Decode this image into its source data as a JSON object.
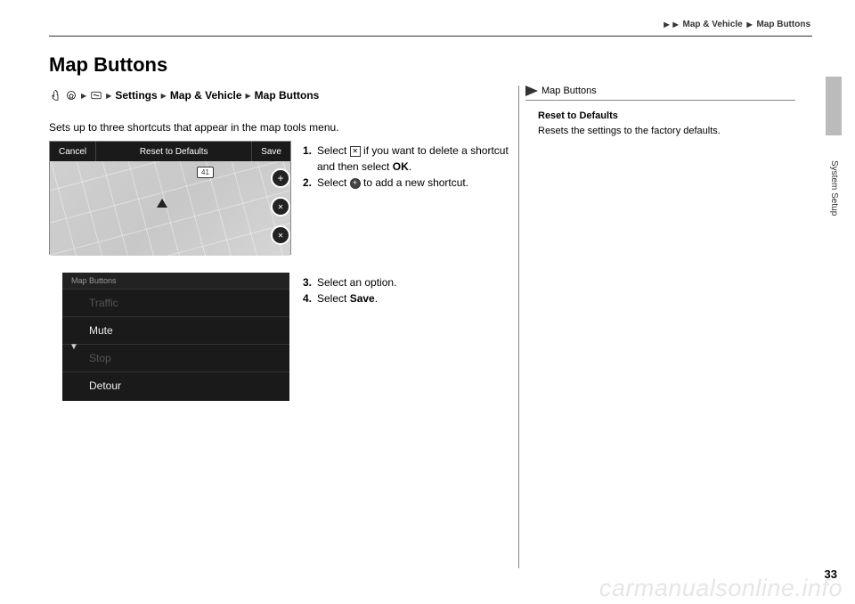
{
  "breadcrumb_top": {
    "level1": "Map & Vehicle",
    "level2": "Map Buttons"
  },
  "page_title": "Map Buttons",
  "path": {
    "settings": "Settings",
    "mv": "Map & Vehicle",
    "mb": "Map Buttons"
  },
  "intro": "Sets up to three shortcuts that appear in the map tools menu.",
  "shot1": {
    "cancel": "Cancel",
    "reset": "Reset to Defaults",
    "save": "Save",
    "badge": "41"
  },
  "shot2": {
    "header": "Map Buttons",
    "r1": "Traffic",
    "r2": "Mute",
    "r3": "Stop",
    "r4": "Detour"
  },
  "steps": {
    "s1_num": "1.",
    "s1_a": "Select ",
    "s1_b": " if you want to delete a shortcut and then select ",
    "s1_c": "OK",
    "s1_d": ".",
    "s2_num": "2.",
    "s2_a": "Select ",
    "s2_b": " to add a new shortcut.",
    "s3_num": "3.",
    "s3_a": "Select an option.",
    "s4_num": "4.",
    "s4_a": "Select ",
    "s4_b": "Save",
    "s4_c": "."
  },
  "sidebar": {
    "head": "Map Buttons",
    "t1": "Reset to Defaults",
    "t2": "Resets the settings to the factory defaults."
  },
  "section_label": "System Setup",
  "page_number": "33",
  "watermark": "carmanualsonline.info"
}
